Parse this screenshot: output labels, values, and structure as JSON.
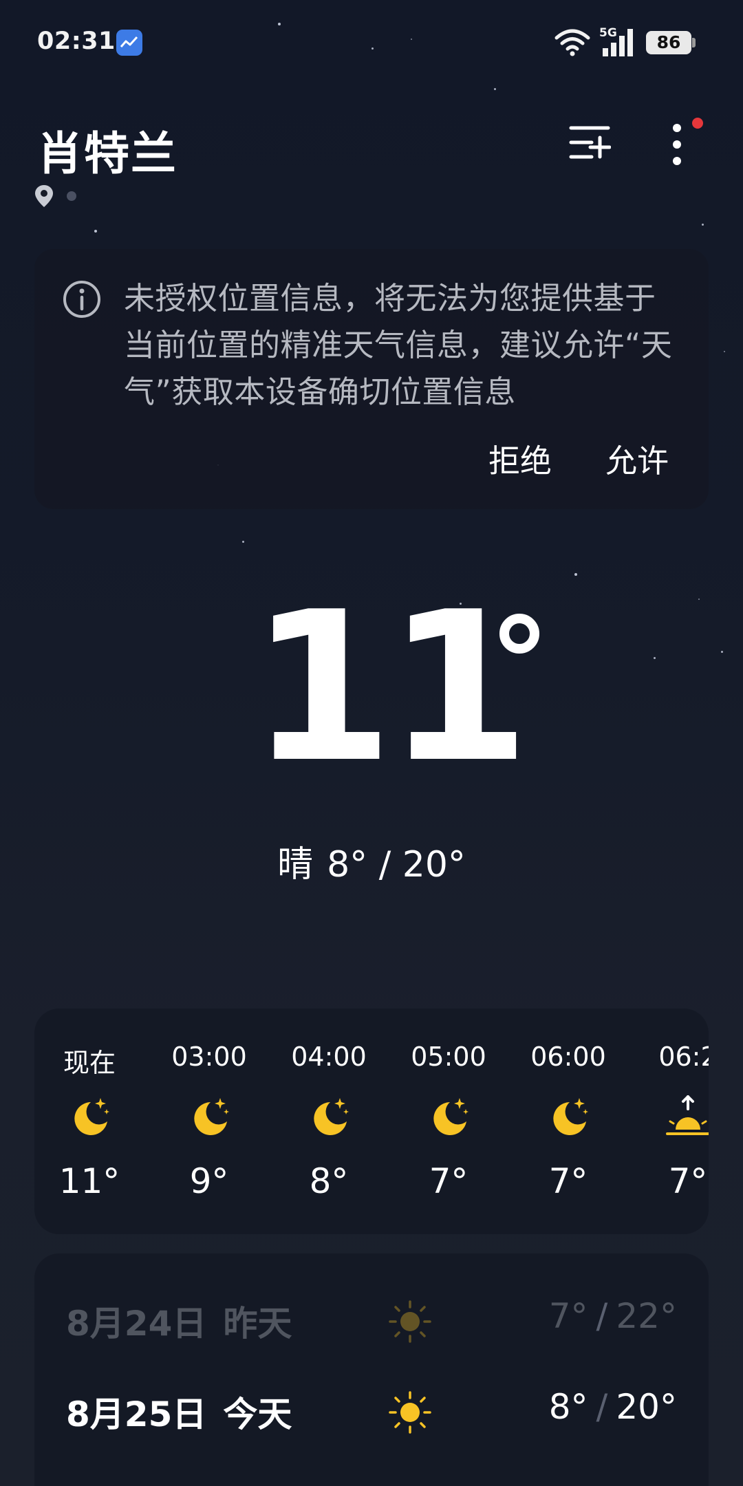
{
  "status_bar": {
    "time": "02:31",
    "network": "5G",
    "battery": "86"
  },
  "header": {
    "city": "肖特兰"
  },
  "permission_card": {
    "message": "未授权位置信息，将无法为您提供基于当前位置的精准天气信息，建议允许“天气”获取本设备确切位置信息",
    "deny_label": "拒绝",
    "allow_label": "允许"
  },
  "current": {
    "temperature": "11",
    "condition": "晴",
    "range": "8° / 20°"
  },
  "hourly": [
    {
      "time": "现在",
      "icon": "moon-stars-icon",
      "temp": "11°"
    },
    {
      "time": "03:00",
      "icon": "moon-stars-icon",
      "temp": "9°"
    },
    {
      "time": "04:00",
      "icon": "moon-stars-icon",
      "temp": "8°"
    },
    {
      "time": "05:00",
      "icon": "moon-stars-icon",
      "temp": "7°"
    },
    {
      "time": "06:00",
      "icon": "moon-stars-icon",
      "temp": "7°"
    },
    {
      "time": "06:2",
      "icon": "sunrise-icon",
      "temp": "7°"
    }
  ],
  "daily": [
    {
      "date": "8月24日",
      "label": "昨天",
      "icon": "sun-icon",
      "low": "7°",
      "high": "22°",
      "past": true
    },
    {
      "date": "8月25日",
      "label": "今天",
      "icon": "sun-icon",
      "low": "8°",
      "high": "20°",
      "past": false
    }
  ],
  "colors": {
    "accent_yellow": "#f7c325",
    "notification_red": "#e5373b",
    "background": "#161b27",
    "card": "#141925"
  }
}
